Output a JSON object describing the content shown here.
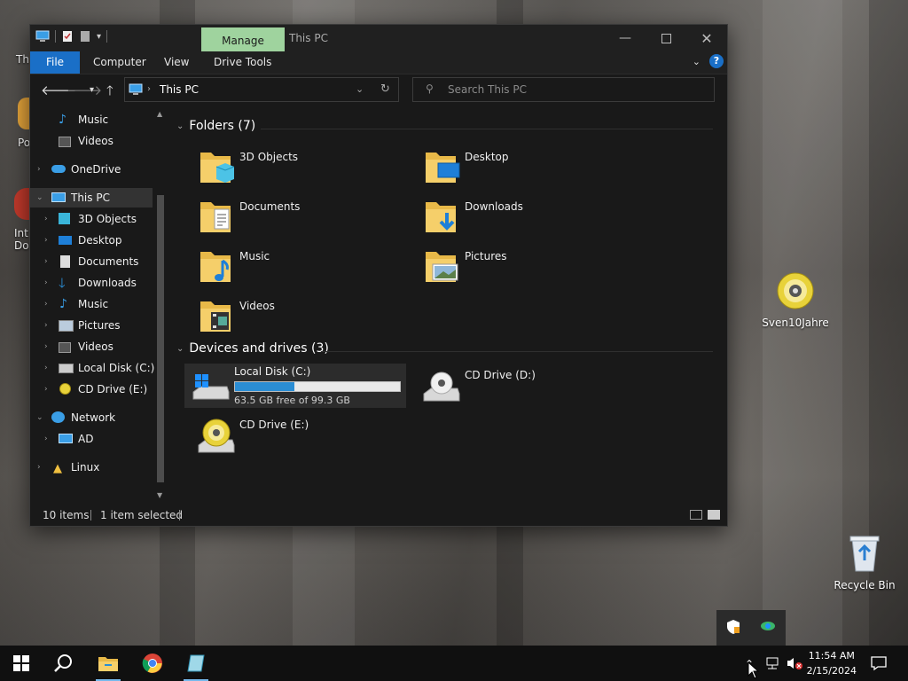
{
  "desktop": {
    "icons": [
      {
        "label": "Sven10Jahre",
        "icon": "cd-icon"
      },
      {
        "label": "Recycle Bin",
        "icon": "recycle-bin-icon"
      }
    ],
    "partial_labels": {
      "top": "Th",
      "pow": "Pow",
      "int1": "Int",
      "int2": "Dov"
    }
  },
  "window": {
    "title": "This PC",
    "context_tab": "Manage",
    "ribbon_tabs": [
      "File",
      "Computer",
      "View",
      "Drive Tools"
    ],
    "help_label": "?",
    "address": "This PC",
    "search_placeholder": "Search This PC"
  },
  "navpane": {
    "items": [
      {
        "label": "Music",
        "icon": "music-icon"
      },
      {
        "label": "Videos",
        "icon": "videos-icon"
      },
      {
        "label": "OneDrive",
        "icon": "onedrive-icon"
      },
      {
        "label": "This PC",
        "icon": "this-pc-icon"
      },
      {
        "label": "3D Objects",
        "icon": "3d-objects-icon"
      },
      {
        "label": "Desktop",
        "icon": "desktop-icon"
      },
      {
        "label": "Documents",
        "icon": "documents-icon"
      },
      {
        "label": "Downloads",
        "icon": "downloads-icon"
      },
      {
        "label": "Music",
        "icon": "music-icon"
      },
      {
        "label": "Pictures",
        "icon": "pictures-icon"
      },
      {
        "label": "Videos",
        "icon": "videos-icon"
      },
      {
        "label": "Local Disk (C:)",
        "icon": "local-disk-icon"
      },
      {
        "label": "CD Drive (E:)",
        "icon": "cd-drive-icon"
      },
      {
        "label": "Network",
        "icon": "network-icon"
      },
      {
        "label": "AD",
        "icon": "computer-icon"
      },
      {
        "label": "Linux",
        "icon": "linux-icon"
      }
    ]
  },
  "content": {
    "folders_header": "Folders (7)",
    "folders": [
      "3D Objects",
      "Desktop",
      "Documents",
      "Downloads",
      "Music",
      "Pictures",
      "Videos"
    ],
    "drives_header": "Devices and drives (3)",
    "drives": [
      {
        "name": "Local Disk (C:)",
        "free_text": "63.5 GB free of 99.3 GB",
        "used_fraction": 0.36
      },
      {
        "name": "CD Drive (D:)"
      },
      {
        "name": "CD Drive (E:)"
      }
    ]
  },
  "status": {
    "count": "10 items",
    "selected": "1 item selected"
  },
  "taskbar": {
    "time": "11:54 AM",
    "date": "2/15/2024",
    "accent": "#76b9ed"
  }
}
